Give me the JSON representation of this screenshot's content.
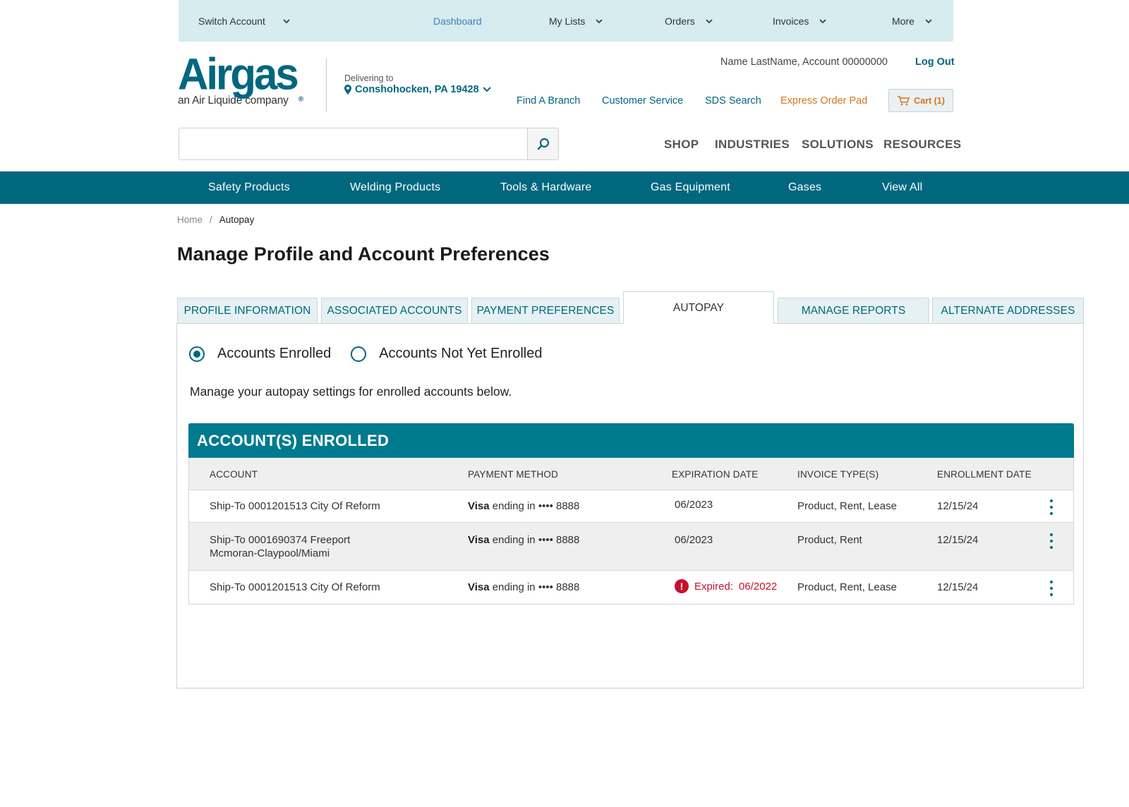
{
  "utility_bar": {
    "switch_account": "Switch Account",
    "dashboard": "Dashboard",
    "my_lists": "My Lists",
    "orders": "Orders",
    "invoices": "Invoices",
    "more": "More"
  },
  "brand": {
    "logo_word": "Airgas",
    "logo_mark": "®",
    "tagline": "an Air Liquide company",
    "primary_color": "#00677f",
    "accent_orange": "#d9731b"
  },
  "delivery": {
    "label": "Delivering to",
    "location": "Conshohocken, PA 19428"
  },
  "account": {
    "name_line": "Name LastName, Account 00000000",
    "logout": "Log Out"
  },
  "header_links": {
    "find_branch": "Find A Branch",
    "customer_service": "Customer Service",
    "sds_search": "SDS Search",
    "express_order_pad": "Express Order Pad",
    "cart": "Cart (1)"
  },
  "search": {
    "value": "",
    "placeholder": ""
  },
  "main_nav": {
    "shop": "SHOP",
    "industries": "INDUSTRIES",
    "solutions": "SOLUTIONS",
    "resources": "RESOURCES"
  },
  "categories": {
    "safety": "Safety Products",
    "welding": "Welding Products",
    "tools": "Tools & Hardware",
    "gas_equipment": "Gas Equipment",
    "gases": "Gases",
    "view_all": "View All"
  },
  "breadcrumb": {
    "home": "Home",
    "separator": "/",
    "current": "Autopay"
  },
  "page_title": "Manage Profile and Account Preferences",
  "tabs": {
    "profile": "PROFILE INFORMATION",
    "associated": "ASSOCIATED ACCOUNTS",
    "payment": "PAYMENT PREFERENCES",
    "autopay": "AUTOPAY",
    "reports": "MANAGE REPORTS",
    "addresses": "ALTERNATE ADDRESSES"
  },
  "filter": {
    "enrolled": "Accounts Enrolled",
    "not_enrolled": "Accounts Not Yet Enrolled",
    "selected": "enrolled"
  },
  "intro": "Manage your autopay settings for enrolled accounts below.",
  "table": {
    "caption": "ACCOUNT(S) ENROLLED",
    "headers": {
      "account": "ACCOUNT",
      "payment_method": "PAYMENT METHOD",
      "expiration": "EXPIRATION DATE",
      "invoice_types": "INVOICE TYPE(S)",
      "enrollment": "ENROLLMENT DATE"
    },
    "rows": [
      {
        "account": "Ship-To 0001201513 City Of Reform",
        "card_brand": "Visa",
        "card_text": "ending in •••• 8888",
        "expiration": "06/2023",
        "invoice_types": "Product, Rent, Lease",
        "enrollment": "12/15/24"
      },
      {
        "account_line1": "Ship-To 0001690374 Freeport",
        "account_line2": "Mcmoran-Claypool/Miami",
        "card_brand": "Visa",
        "card_text": "ending in •••• 8888",
        "expiration": "06/2023",
        "invoice_types": "Product, Rent",
        "enrollment": "12/15/24"
      },
      {
        "account": "Ship-To 0001201513 City Of Reform",
        "card_brand": "Visa",
        "card_text": "ending in •••• 8888",
        "expired_label": "Expired:",
        "expiration": "06/2022",
        "invoice_types": "Product, Rent, Lease",
        "enrollment": "12/15/24"
      }
    ]
  },
  "colors": {
    "utility_bg": "#d6ecee",
    "category_bar": "#00677f",
    "table_caption": "#007a8e",
    "error": "#c8102e"
  }
}
